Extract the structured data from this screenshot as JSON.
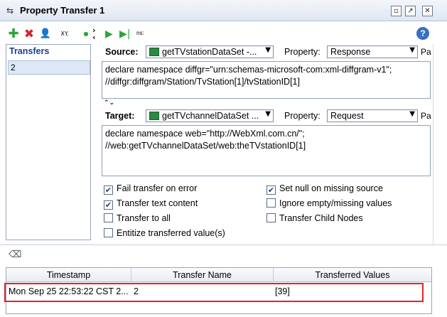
{
  "window": {
    "title": "Property Transfer 1",
    "title_icon": "transfer-icon",
    "buttons": [
      "restore-icon",
      "detach-icon",
      "close-icon"
    ]
  },
  "left_toolbar": {
    "add_icon": "plus-icon",
    "delete_icon": "x-icon",
    "user_icon": "user-icon",
    "xy_label": "XY."
  },
  "transfers": {
    "header": "Transfers",
    "items": [
      "2"
    ]
  },
  "right_toolbar": {
    "ns_label": "ns:"
  },
  "source": {
    "label": "Source:",
    "step": "getTVstationDataSet -...",
    "property_label": "Property:",
    "property": "Response",
    "pa_label": "Pa",
    "expression_line1": "declare namespace diffgr=\"urn:schemas-microsoft-com:xml-diffgram-v1\";",
    "expression_line2": "//diffgr:diffgram/Station/TvStation[1]/tvStationID[1]"
  },
  "target": {
    "label": "Target:",
    "step": "getTVchannelDataSet ...",
    "property_label": "Property:",
    "property": "Request",
    "pa_label": "Pa",
    "expression_line1": "declare namespace web=\"http://WebXml.com.cn/\";",
    "expression_line2": "//web:getTVchannelDataSet/web:theTVstationID[1]"
  },
  "options": {
    "fail_transfer": {
      "label": "Fail transfer on error",
      "checked": true
    },
    "transfer_text": {
      "label": "Transfer text content",
      "checked": true
    },
    "transfer_all": {
      "label": "Transfer to all",
      "checked": false
    },
    "entitize": {
      "label": "Entitize transferred value(s)",
      "checked": false
    },
    "set_null": {
      "label": "Set null on missing source",
      "checked": true
    },
    "ignore_empty": {
      "label": "Ignore empty/missing values",
      "checked": false
    },
    "transfer_child": {
      "label": "Transfer Child Nodes",
      "checked": false
    }
  },
  "log": {
    "columns": [
      "Timestamp",
      "Transfer Name",
      "Transferred Values"
    ],
    "rows": [
      {
        "timestamp": "Mon Sep 25 22:53:22 CST 2...",
        "name": "2",
        "values": "[39]"
      }
    ]
  },
  "colors": {
    "highlight": "#e2232a",
    "transfers_header": "#1a3f8f",
    "play": "#2aa53b"
  }
}
